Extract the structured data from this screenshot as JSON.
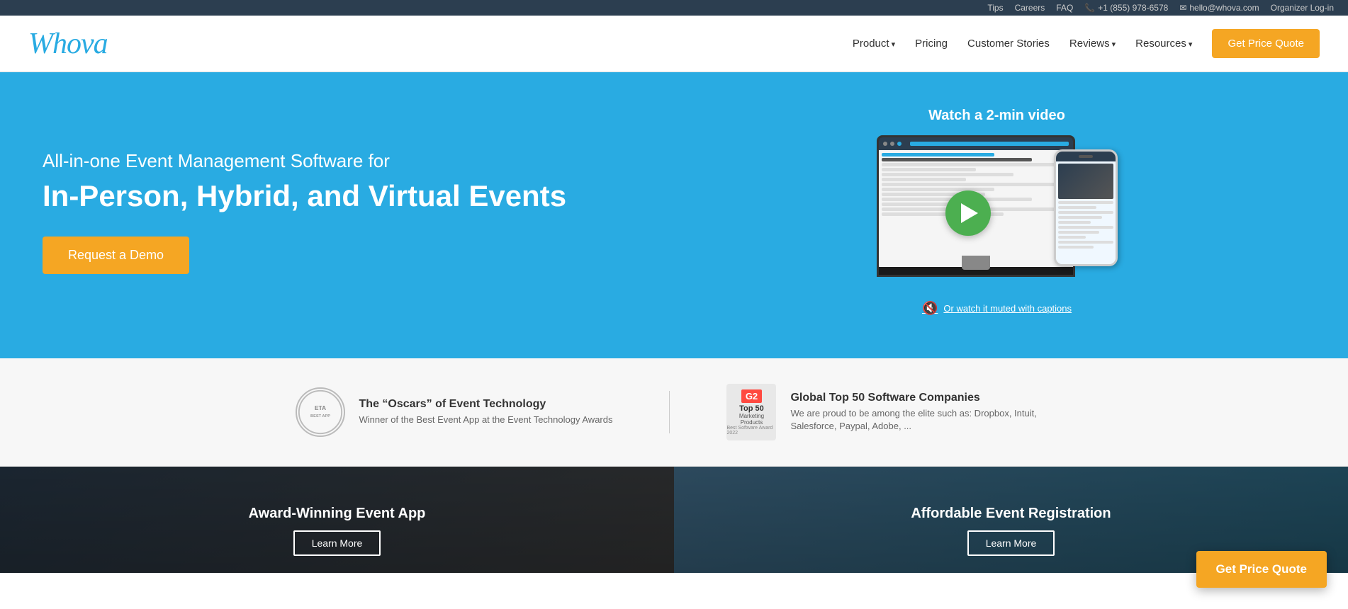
{
  "topbar": {
    "links": [
      "Tips",
      "Careers",
      "FAQ"
    ],
    "phone": "+1 (855) 978-6578",
    "email": "hello@whova.com",
    "organizer": "Organizer Log-in"
  },
  "navbar": {
    "logo": "Whova",
    "links": [
      {
        "label": "Product",
        "has_arrow": true
      },
      {
        "label": "Pricing",
        "has_arrow": false
      },
      {
        "label": "Customer Stories",
        "has_arrow": false
      },
      {
        "label": "Reviews",
        "has_arrow": true
      },
      {
        "label": "Resources",
        "has_arrow": true
      }
    ],
    "cta": "Get Price Quote"
  },
  "hero": {
    "subtitle": "All-in-one Event Management Software for",
    "title": "In-Person, Hybrid, and Virtual Events",
    "demo_btn": "Request a Demo",
    "video_label": "Watch a 2-min video",
    "muted_text": "Or watch it muted with captions"
  },
  "awards": {
    "left": {
      "title": "The “Oscars” of Event Technology",
      "desc": "Winner of the Best Event App at the Event Technology Awards",
      "badge": "ETA"
    },
    "right": {
      "title": "Global Top 50 Software Companies",
      "desc": "We are proud to be among the elite such as: Dropbox, Intuit, Salesforce, Paypal, Adobe, ...",
      "badge": "Top 50"
    }
  },
  "cards": [
    {
      "title": "Award-Winning Event App",
      "btn": "Learn More"
    },
    {
      "title": "Affordable Event Registration",
      "btn": "Learn More"
    }
  ],
  "floating_cta": "Get Price Quote"
}
